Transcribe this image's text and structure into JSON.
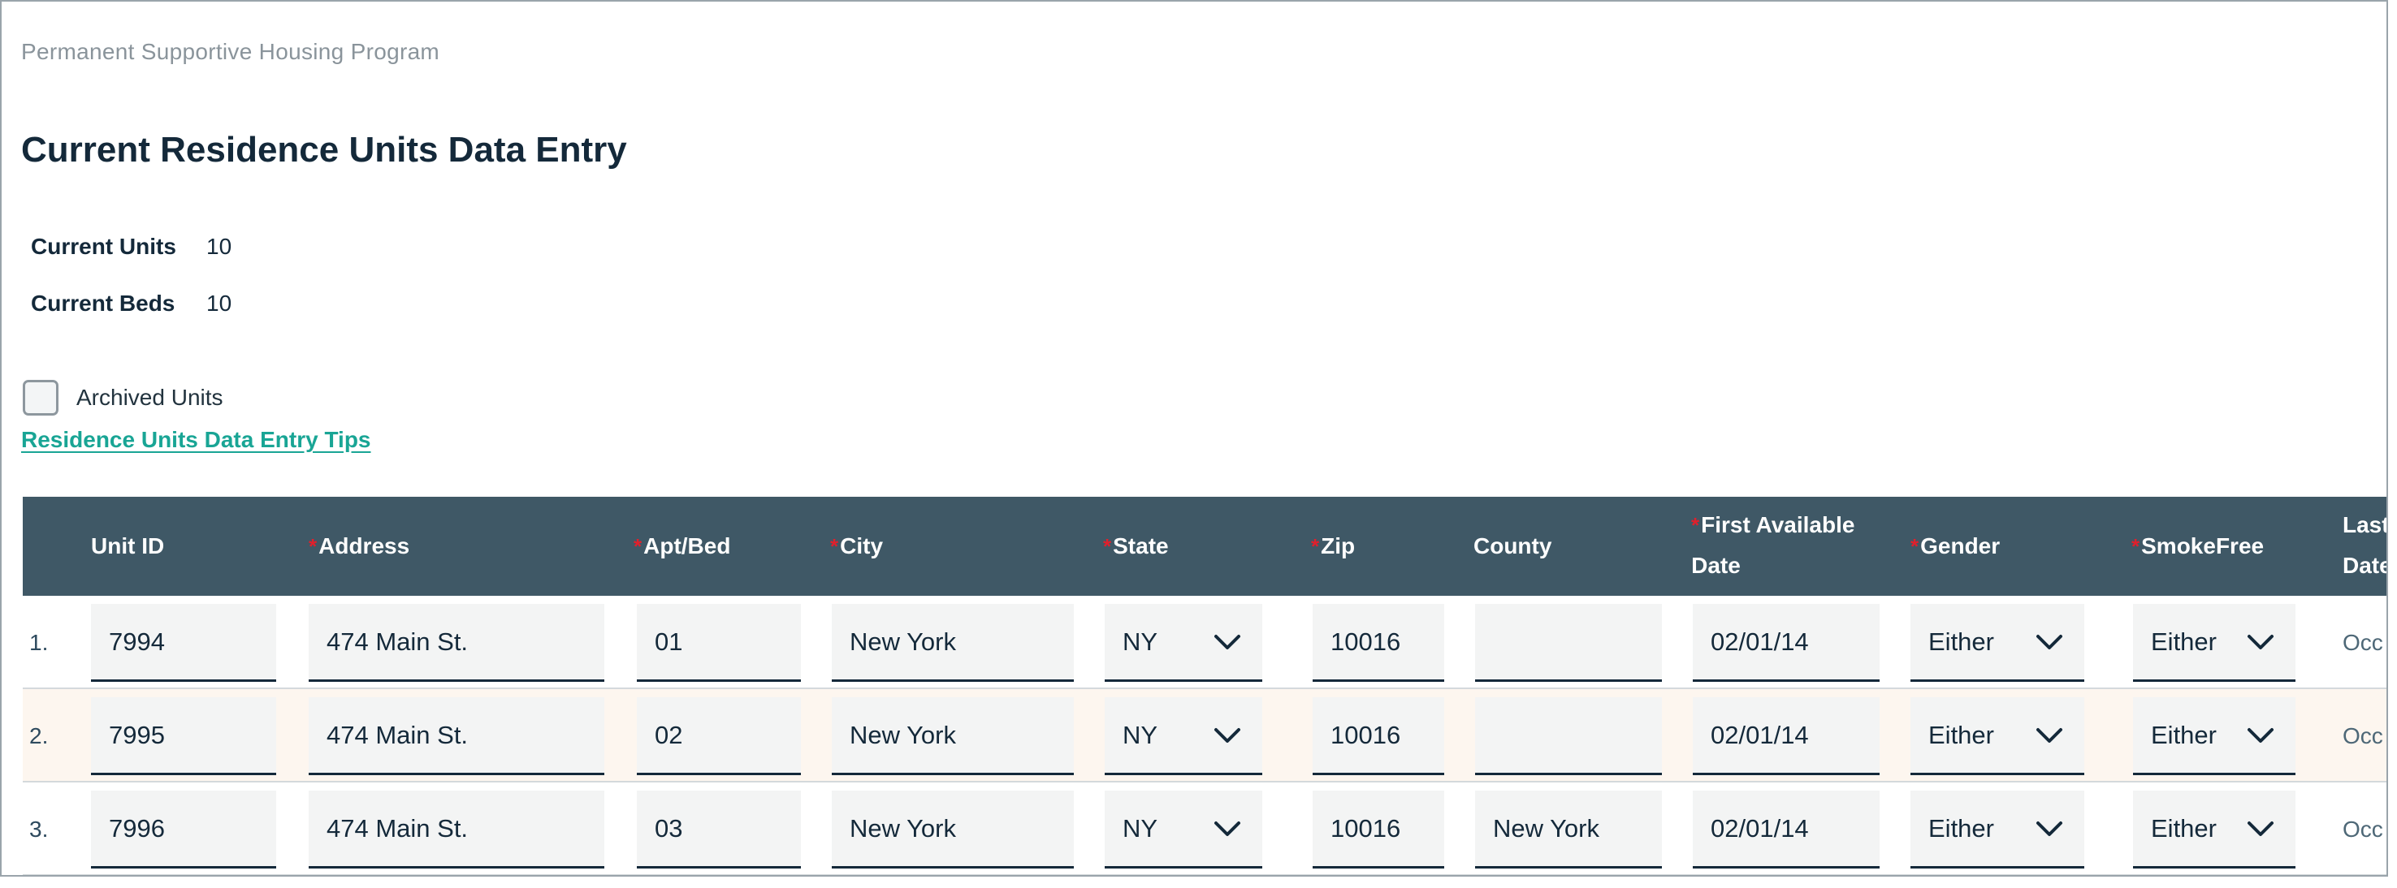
{
  "page": {
    "program": "Permanent Supportive Housing Program",
    "title": "Current Residence Units Data Entry"
  },
  "stats": {
    "units_label": "Current Units",
    "units_value": "10",
    "beds_label": "Current Beds",
    "beds_value": "10"
  },
  "archived": {
    "label": "Archived Units",
    "checked": false
  },
  "tips_link": "Residence Units Data Entry Tips",
  "table": {
    "required_mark": "*",
    "headers": {
      "unit_id": "Unit ID",
      "address": "Address",
      "apt_bed": "Apt/Bed",
      "city": "City",
      "state": "State",
      "zip": "Zip",
      "county": "County",
      "first_available_line1": "First Available",
      "first_available_line2": "Date",
      "gender": "Gender",
      "smokefree": "SmokeFree",
      "last_line1": "Last",
      "last_line2": "Date"
    },
    "rows": [
      {
        "num": "1.",
        "unit_id": "7994",
        "address": "474 Main St.",
        "apt_bed": "01",
        "city": "New York",
        "state": "NY",
        "zip": "10016",
        "county": "",
        "first_available": "02/01/14",
        "gender": "Either",
        "smokefree": "Either",
        "last": "Occ"
      },
      {
        "num": "2.",
        "unit_id": "7995",
        "address": "474 Main St.",
        "apt_bed": "02",
        "city": "New York",
        "state": "NY",
        "zip": "10016",
        "county": "",
        "first_available": "02/01/14",
        "gender": "Either",
        "smokefree": "Either",
        "last": "Occ"
      },
      {
        "num": "3.",
        "unit_id": "7996",
        "address": "474 Main St.",
        "apt_bed": "03",
        "city": "New York",
        "state": "NY",
        "zip": "10016",
        "county": "New York",
        "first_available": "02/01/14",
        "gender": "Either",
        "smokefree": "Either",
        "last": "Occ"
      }
    ]
  },
  "colors": {
    "header_bg": "#3f5866",
    "link": "#19a595",
    "required": "#e0202c",
    "alt_row": "#fdf6ef"
  },
  "icons": {
    "dropdown": "chevron-down-icon"
  }
}
